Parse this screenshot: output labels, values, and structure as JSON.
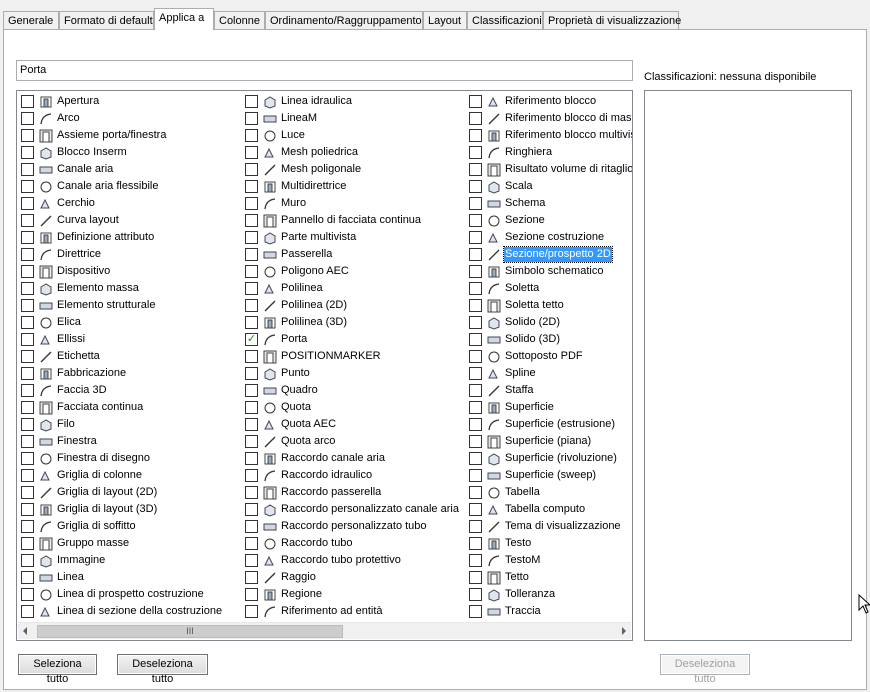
{
  "tabs": [
    {
      "label": "Generale"
    },
    {
      "label": "Formato di default"
    },
    {
      "label": "Applica a"
    },
    {
      "label": "Colonne"
    },
    {
      "label": "Ordinamento/Raggruppamento"
    },
    {
      "label": "Layout"
    },
    {
      "label": "Classificazioni"
    },
    {
      "label": "Proprietà di visualizzazione"
    }
  ],
  "active_tab": "Applica a",
  "name_field": {
    "value": "Porta"
  },
  "classifications": {
    "label": "Classificazioni: nessuna disponibile"
  },
  "columns": [
    [
      {
        "label": "Apertura",
        "icon": "opening-icon",
        "checked": false
      },
      {
        "label": "Arco",
        "icon": "arc-icon",
        "checked": false
      },
      {
        "label": "Assieme porta/finestra",
        "icon": "door-window-assembly-icon",
        "checked": false
      },
      {
        "label": "Blocco Inserm",
        "icon": "block-insert-icon",
        "checked": false
      },
      {
        "label": "Canale aria",
        "icon": "duct-icon",
        "checked": false
      },
      {
        "label": "Canale aria flessibile",
        "icon": "flex-duct-icon",
        "checked": false
      },
      {
        "label": "Cerchio",
        "icon": "circle-icon",
        "checked": false
      },
      {
        "label": "Curva layout",
        "icon": "layout-curve-icon",
        "checked": false
      },
      {
        "label": "Definizione attributo",
        "icon": "attribute-definition-icon",
        "checked": false
      },
      {
        "label": "Direttrice",
        "icon": "leader-icon",
        "checked": false
      },
      {
        "label": "Dispositivo",
        "icon": "device-icon",
        "checked": false
      },
      {
        "label": "Elemento massa",
        "icon": "mass-element-icon",
        "checked": false
      },
      {
        "label": "Elemento strutturale",
        "icon": "structural-member-icon",
        "checked": false
      },
      {
        "label": "Elica",
        "icon": "helix-icon",
        "checked": false
      },
      {
        "label": "Ellissi",
        "icon": "ellipse-icon",
        "checked": false
      },
      {
        "label": "Etichetta",
        "icon": "label-icon",
        "checked": false
      },
      {
        "label": "Fabbricazione",
        "icon": "fabrication-icon",
        "checked": false
      },
      {
        "label": "Faccia 3D",
        "icon": "3d-face-icon",
        "checked": false
      },
      {
        "label": "Facciata continua",
        "icon": "curtain-wall-icon",
        "checked": false
      },
      {
        "label": "Filo",
        "icon": "wire-icon",
        "checked": false
      },
      {
        "label": "Finestra",
        "icon": "window-icon",
        "checked": false
      },
      {
        "label": "Finestra di disegno",
        "icon": "viewport-icon",
        "checked": false
      },
      {
        "label": "Griglia di colonne",
        "icon": "column-grid-icon",
        "checked": false
      },
      {
        "label": "Griglia di layout (2D)",
        "icon": "layout-grid-2d-icon",
        "checked": false
      },
      {
        "label": "Griglia di layout (3D)",
        "icon": "layout-grid-3d-icon",
        "checked": false
      },
      {
        "label": "Griglia di soffitto",
        "icon": "ceiling-grid-icon",
        "checked": false
      },
      {
        "label": "Gruppo masse",
        "icon": "mass-group-icon",
        "checked": false
      },
      {
        "label": "Immagine",
        "icon": "image-icon",
        "checked": false
      },
      {
        "label": "Linea",
        "icon": "line-icon",
        "checked": false
      },
      {
        "label": "Linea di prospetto costruzione",
        "icon": "elevation-line-icon",
        "checked": false
      },
      {
        "label": "Linea di sezione della costruzione",
        "icon": "section-line-icon",
        "checked": false
      }
    ],
    [
      {
        "label": "Linea idraulica",
        "icon": "pipe-line-icon",
        "checked": false
      },
      {
        "label": "LineaM",
        "icon": "mline-icon",
        "checked": false
      },
      {
        "label": "Luce",
        "icon": "light-icon",
        "checked": false
      },
      {
        "label": "Mesh poliedrica",
        "icon": "polyface-mesh-icon",
        "checked": false
      },
      {
        "label": "Mesh poligonale",
        "icon": "polygon-mesh-icon",
        "checked": false
      },
      {
        "label": "Multidirettrice",
        "icon": "multileader-icon",
        "checked": false
      },
      {
        "label": "Muro",
        "icon": "wall-icon",
        "checked": false
      },
      {
        "label": "Pannello di facciata continua",
        "icon": "curtain-wall-panel-icon",
        "checked": false
      },
      {
        "label": "Parte multivista",
        "icon": "multiview-part-icon",
        "checked": false
      },
      {
        "label": "Passerella",
        "icon": "cable-tray-icon",
        "checked": false
      },
      {
        "label": "Poligono AEC",
        "icon": "aec-polygon-icon",
        "checked": false
      },
      {
        "label": "Polilinea",
        "icon": "polyline-icon",
        "checked": false
      },
      {
        "label": "Polilinea (2D)",
        "icon": "polyline-2d-icon",
        "checked": false
      },
      {
        "label": "Polilinea (3D)",
        "icon": "polyline-3d-icon",
        "checked": false
      },
      {
        "label": "Porta",
        "icon": "door-icon",
        "checked": true
      },
      {
        "label": "POSITIONMARKER",
        "icon": "position-marker-icon",
        "checked": false
      },
      {
        "label": "Punto",
        "icon": "point-icon",
        "checked": false
      },
      {
        "label": "Quadro",
        "icon": "panel-board-icon",
        "checked": false
      },
      {
        "label": "Quota",
        "icon": "dimension-icon",
        "checked": false
      },
      {
        "label": "Quota AEC",
        "icon": "aec-dimension-icon",
        "checked": false
      },
      {
        "label": "Quota arco",
        "icon": "arc-dimension-icon",
        "checked": false
      },
      {
        "label": "Raccordo canale aria",
        "icon": "duct-fitting-icon",
        "checked": false
      },
      {
        "label": "Raccordo idraulico",
        "icon": "pipe-fitting-icon",
        "checked": false
      },
      {
        "label": "Raccordo passerella",
        "icon": "cable-tray-fitting-icon",
        "checked": false
      },
      {
        "label": "Raccordo personalizzato canale aria",
        "icon": "custom-duct-fitting-icon",
        "checked": false
      },
      {
        "label": "Raccordo personalizzato tubo",
        "icon": "custom-pipe-fitting-icon",
        "checked": false
      },
      {
        "label": "Raccordo tubo",
        "icon": "conduit-fitting-icon",
        "checked": false
      },
      {
        "label": "Raccordo tubo protettivo",
        "icon": "protective-conduit-fitting-icon",
        "checked": false
      },
      {
        "label": "Raggio",
        "icon": "ray-icon",
        "checked": false
      },
      {
        "label": "Regione",
        "icon": "region-icon",
        "checked": false
      },
      {
        "label": "Riferimento ad entità",
        "icon": "entity-reference-icon",
        "checked": false
      }
    ],
    [
      {
        "label": "Riferimento blocco",
        "icon": "block-reference-icon",
        "checked": false
      },
      {
        "label": "Riferimento blocco di masch",
        "icon": "masking-block-reference-icon",
        "checked": false
      },
      {
        "label": "Riferimento blocco multivist",
        "icon": "multiview-block-reference-icon",
        "checked": false
      },
      {
        "label": "Ringhiera",
        "icon": "railing-icon",
        "checked": false
      },
      {
        "label": "Risultato volume di ritaglio",
        "icon": "clip-volume-result-icon",
        "checked": false
      },
      {
        "label": "Scala",
        "icon": "stair-icon",
        "checked": false
      },
      {
        "label": "Schema",
        "icon": "schematic-icon",
        "checked": false
      },
      {
        "label": "Sezione",
        "icon": "section-icon",
        "checked": false
      },
      {
        "label": "Sezione costruzione",
        "icon": "building-section-icon",
        "checked": false
      },
      {
        "label": "Sezione/prospetto 2D",
        "icon": "2d-section-elevation-icon",
        "checked": false,
        "selected": true
      },
      {
        "label": "Simbolo schematico",
        "icon": "schematic-symbol-icon",
        "checked": false
      },
      {
        "label": "Soletta",
        "icon": "slab-icon",
        "checked": false
      },
      {
        "label": "Soletta tetto",
        "icon": "roof-slab-icon",
        "checked": false
      },
      {
        "label": "Solido (2D)",
        "icon": "solid-2d-icon",
        "checked": false
      },
      {
        "label": "Solido (3D)",
        "icon": "solid-3d-icon",
        "checked": false
      },
      {
        "label": "Sottoposto PDF",
        "icon": "pdf-underlay-icon",
        "checked": false
      },
      {
        "label": "Spline",
        "icon": "spline-icon",
        "checked": false
      },
      {
        "label": "Staffa",
        "icon": "hanger-icon",
        "checked": false
      },
      {
        "label": "Superficie",
        "icon": "surface-icon",
        "checked": false
      },
      {
        "label": "Superficie (estrusione)",
        "icon": "extruded-surface-icon",
        "checked": false
      },
      {
        "label": "Superficie (piana)",
        "icon": "planar-surface-icon",
        "checked": false
      },
      {
        "label": "Superficie (rivoluzione)",
        "icon": "revolved-surface-icon",
        "checked": false
      },
      {
        "label": "Superficie (sweep)",
        "icon": "swept-surface-icon",
        "checked": false
      },
      {
        "label": "Tabella",
        "icon": "table-icon",
        "checked": false
      },
      {
        "label": "Tabella computo",
        "icon": "schedule-table-icon",
        "checked": false
      },
      {
        "label": "Tema di visualizzazione",
        "icon": "display-theme-icon",
        "checked": false
      },
      {
        "label": "Testo",
        "icon": "text-icon",
        "checked": false
      },
      {
        "label": "TestoM",
        "icon": "mtext-icon",
        "checked": false
      },
      {
        "label": "Tetto",
        "icon": "roof-icon",
        "checked": false
      },
      {
        "label": "Tolleranza",
        "icon": "tolerance-icon",
        "checked": false
      },
      {
        "label": "Traccia",
        "icon": "trace-icon",
        "checked": false
      }
    ]
  ],
  "scrollbar": {
    "thumb_grip": "III"
  },
  "buttons": {
    "select_all": "Seleziona tutto",
    "deselect_all": "Deseleziona tutto",
    "class_deselect_all": "Deseleziona tutto"
  },
  "colors": {
    "selection": "#3399ff",
    "check": "#2a8a2a"
  }
}
